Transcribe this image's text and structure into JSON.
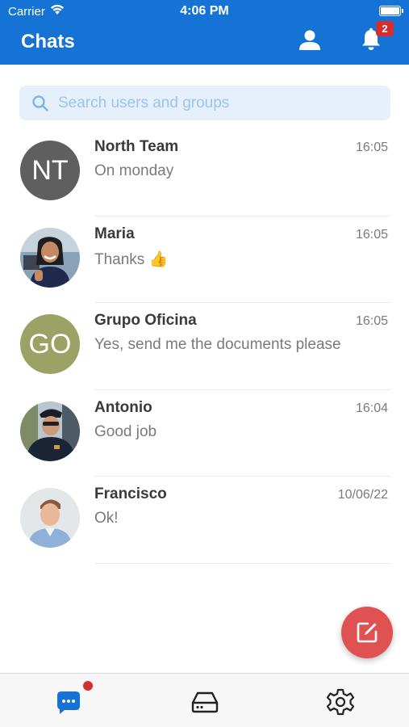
{
  "status_bar": {
    "carrier": "Carrier",
    "time": "4:06 PM"
  },
  "header": {
    "title": "Chats",
    "notification_count": "2"
  },
  "search": {
    "placeholder": "Search users and groups"
  },
  "chats": [
    {
      "name": "North Team",
      "time": "16:05",
      "message": "On monday",
      "avatar_initials": "NT",
      "avatar_color": "#5f5f5f"
    },
    {
      "name": "Maria",
      "time": "16:05",
      "message": "Thanks 👍"
    },
    {
      "name": "Grupo Oficina",
      "time": "16:05",
      "message": "Yes, send me the documents please",
      "avatar_initials": "GO",
      "avatar_color": "#9aa265"
    },
    {
      "name": "Antonio",
      "time": "16:04",
      "message": "Good job"
    },
    {
      "name": "Francisco",
      "time": "10/06/22",
      "message": "Ok!"
    }
  ],
  "colors": {
    "header_bg": "#1673d6",
    "fab": "#e05252",
    "badge": "#d32f2f",
    "active_tab": "#1673d6"
  },
  "icons": {
    "header": [
      "user-icon",
      "bell-icon"
    ],
    "fab": "compose-icon",
    "tabs": [
      "chat-icon",
      "drive-icon",
      "settings-icon"
    ]
  }
}
